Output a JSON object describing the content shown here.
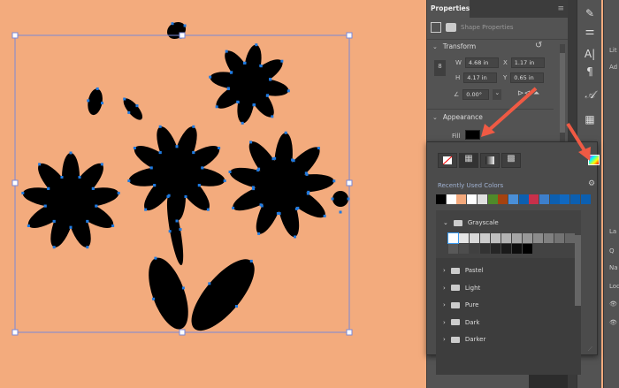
{
  "properties": {
    "tab": "Properties",
    "shape_label": "Shape Properties",
    "transform": "Transform",
    "w_label": "W",
    "w": "4.68 in",
    "h_label": "H",
    "h": "4.17 in",
    "x_label": "X",
    "x": "1.17 in",
    "y_label": "Y",
    "y": "0.65 in",
    "rotation": "0.00°",
    "appearance": "Appearance",
    "fill_label": "Fill",
    "fill_color": "#000000"
  },
  "swatch_popup": {
    "recent_label": "Recently Used Colors",
    "recent_colors": [
      "#000000",
      "#ffffff",
      "#f4a97c",
      "#ffffff",
      "#e0e0e0",
      "#4f8a2a",
      "#a5420f",
      "#4a8fd8",
      "#0c5fb0",
      "#c8304a",
      "#3d7fcc",
      "#0c5fb0",
      "#1068c0",
      "#0c5fb0",
      "#0c5fb0"
    ],
    "groups": [
      {
        "name": "Grayscale",
        "expanded": true
      },
      {
        "name": "Pastel"
      },
      {
        "name": "Light"
      },
      {
        "name": "Pure"
      },
      {
        "name": "Dark"
      },
      {
        "name": "Darker"
      }
    ],
    "grayscale_colors": [
      "#ffffff",
      "#e6e6e6",
      "#d9d9d9",
      "#cccccc",
      "#c0c0c0",
      "#b3b3b3",
      "#a6a6a6",
      "#999999",
      "#8c8c8c",
      "#808080",
      "#737373",
      "#666666",
      "#595959",
      "#4d4d4d",
      "#404040",
      "#333333",
      "#262626",
      "#1a1a1a",
      "#0d0d0d",
      "#000000"
    ]
  },
  "right_panel": {
    "libraries": "Lit",
    "add": "Ad",
    "layers": "La",
    "name": "Na",
    "lock": "Loc"
  },
  "colors": {
    "canvas": "#f3ab7d",
    "selection": "#1f7ae0",
    "arrow": "#f05a44"
  }
}
